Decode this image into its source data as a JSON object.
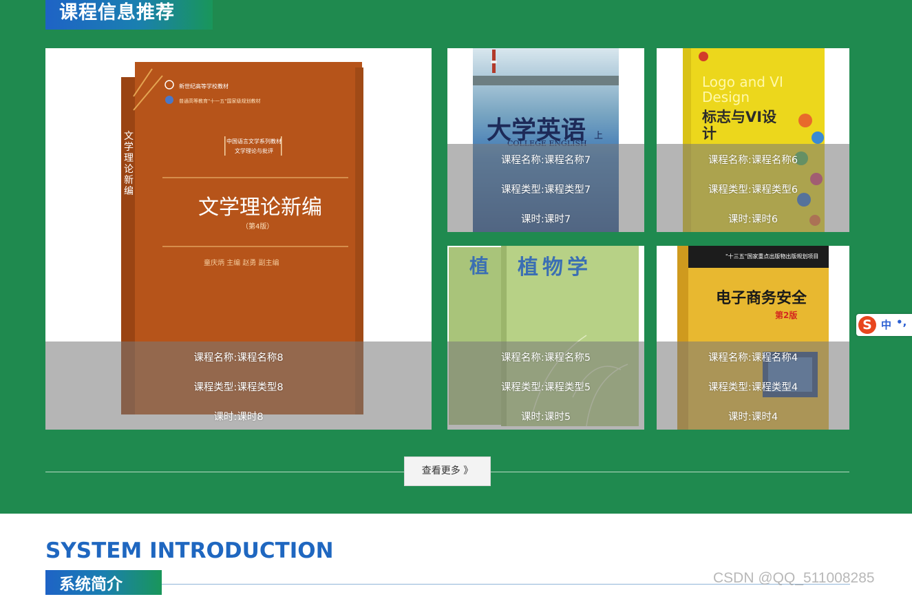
{
  "section": {
    "title": "课程信息推荐"
  },
  "cards": [
    {
      "cover_title": "文学理论新编",
      "cover_edition": "（第4版）",
      "cover_series": "中国语言文学系列教材",
      "cover_subseries": "文学理论与批评",
      "cover_publisher_line1": "新世纪高等学校教材",
      "cover_publisher_line2": "普通高等教育\"十一五\"国家级规划教材",
      "cover_authors": "童庆炳 主编 赵勇 副主编",
      "spine_text": "文学理论新编",
      "name": "课程名称:课程名称8",
      "type": "课程类型:课程类型8",
      "hours": "课时:课时8"
    },
    {
      "cover_title": "大学英语",
      "cover_sub": "COLLEGE ENGLISH",
      "cover_volume": "上",
      "name": "课程名称:课程名称7",
      "type": "课程类型:课程类型7",
      "hours": "课时:课时7"
    },
    {
      "cover_title_en": "Logo and VI Design",
      "cover_title_zh": "标志与VI设计",
      "name": "课程名称:课程名称6",
      "type": "课程类型:课程类型6",
      "hours": "课时:课时6"
    },
    {
      "cover_title": "植物学",
      "cover_spine": "植",
      "name": "课程名称:课程名称5",
      "type": "课程类型:课程类型5",
      "hours": "课时:课时5"
    },
    {
      "cover_banner": "\"十三五\"国家重点出版物出版规划项目",
      "cover_title": "电子商务安全",
      "cover_edition": "第2版",
      "name": "课程名称:课程名称4",
      "type": "课程类型:课程类型4",
      "hours": "课时:课时4"
    }
  ],
  "more_button": {
    "label": "查看更多 》"
  },
  "intro": {
    "title_en": "SYSTEM INTRODUCTION",
    "title_zh": "系统简介"
  },
  "ime": {
    "logo": "S",
    "mode": "中",
    "punct": "•,"
  },
  "watermark": "CSDN @QQ_511008285",
  "colors": {
    "green": "#1f8a4f",
    "blue": "#1f67c0"
  }
}
